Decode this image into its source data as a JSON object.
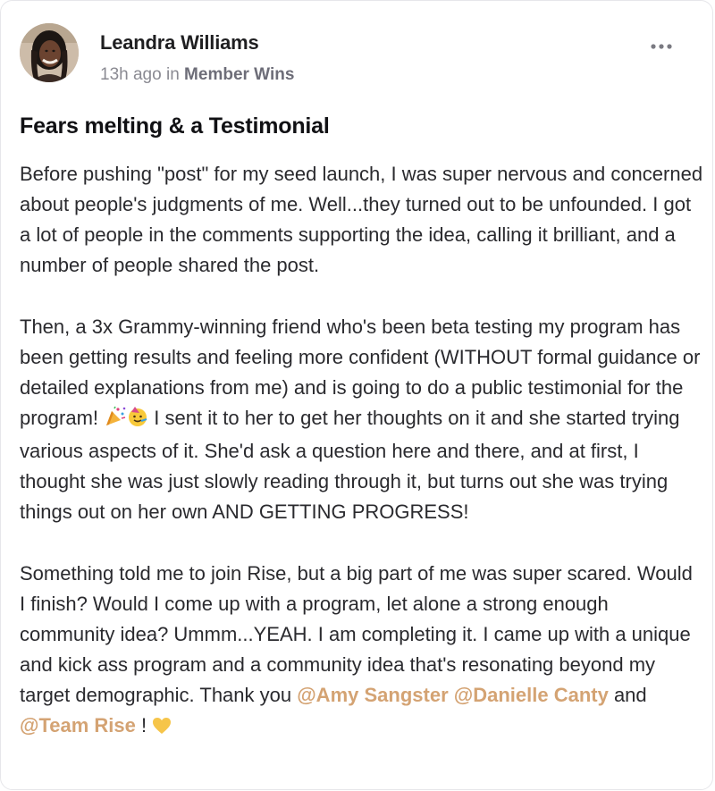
{
  "post": {
    "author": "Leandra Williams",
    "time_ago": "13h ago",
    "in_word": "in",
    "space": "Member Wins",
    "title": "Fears melting & a Testimonial",
    "p1": "Before pushing \"post\" for my seed launch, I was super nervous and concerned about people's judgments of me. Well...they turned out to be unfounded. I got a lot of people in the comments supporting the idea, calling it brilliant, and a number of people shared the post.",
    "p2_before_emoji": "Then, a 3x Grammy-winning friend who's been beta testing my program has been getting results and feeling more confident (WITHOUT formal guidance or detailed explanations from me) and is going to do a public testimonial for the program! ",
    "p2_after_emoji": " I sent it to her to get her thoughts on it and she started trying various aspects of it. She'd ask a question here and there, and at first, I thought she was just slowly reading through it, but turns out she was trying things out on her own AND GETTING PROGRESS!",
    "p3_text": "Something told me to join Rise, but a big part of me was super scared. Would I finish? Would I come up with a program, let alone a strong enough community idea? Ummm...YEAH. I am completing it. I came up with a unique and kick ass program and a community idea that's resonating beyond my target demographic. Thank you ",
    "mention_1": "@Amy Sangster",
    "mention_2": "@Danielle Canty",
    "and_word": " and ",
    "mention_3": "@Team Rise",
    "closing": " ! ",
    "emoji_icons": [
      "party-popper-icon",
      "partying-face-icon",
      "yellow-heart-icon"
    ]
  },
  "colors": {
    "mention": "#d4a373",
    "meta": "#8a8a92"
  }
}
